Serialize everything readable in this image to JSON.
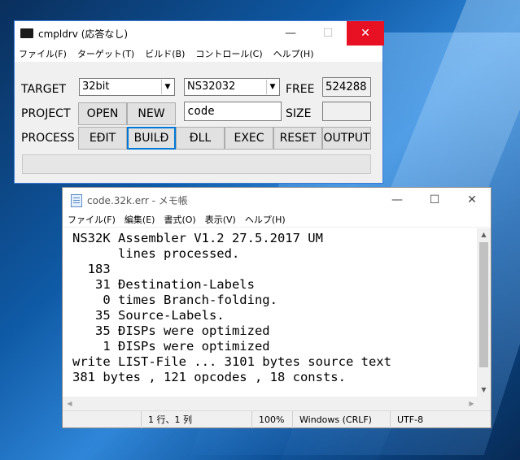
{
  "main_window": {
    "title": "cmpldrv (応答なし)",
    "controls": {
      "minimize": "—",
      "maximize": "☐",
      "close": "✕"
    },
    "menu": [
      "ファイル(F)",
      "ターゲット(T)",
      "ビルド(B)",
      "コントロール(C)",
      "ヘルプ(H)"
    ],
    "labels": {
      "target": "TARGET",
      "project": "PROJECT",
      "process": "PROCESS",
      "free": "FREE",
      "size": "SIZE"
    },
    "target_select": "32bit",
    "cpu_select": "NS32032",
    "free_value": "524288",
    "project_name": "code",
    "size_value": "",
    "buttons": {
      "open": "OPEN",
      "new": "NEW",
      "edit": "EÐIT",
      "build": "BUILÐ",
      "dll": "ÐLL",
      "exec": "EXEC",
      "reset": "RESET",
      "output": "OUTPUT"
    },
    "status": ""
  },
  "notepad": {
    "title": "code.32k.err - メモ帳",
    "controls": {
      "minimize": "—",
      "maximize": "☐",
      "close": "✕"
    },
    "menu": [
      "ファイル(F)",
      "編集(E)",
      "書式(O)",
      "表示(V)",
      "ヘルプ(H)"
    ],
    "lines": [
      "NS32K Assembler V1.2 27.5.2017 UM",
      "      lines processed.",
      "  183",
      "   31 Ðestination-Labels",
      "    0 times Branch-folding.",
      "   35 Source-Labels.",
      "   35 ÐISPs were optimized",
      "    1 ÐISPs were optimized",
      "write LIST-File ... 3101 bytes source text",
      "381 bytes , 121 opcodes , 18 consts."
    ],
    "status": {
      "position": "1 行、1 列",
      "zoom": "100%",
      "line_ending": "Windows (CRLF)",
      "encoding": "UTF-8"
    }
  }
}
